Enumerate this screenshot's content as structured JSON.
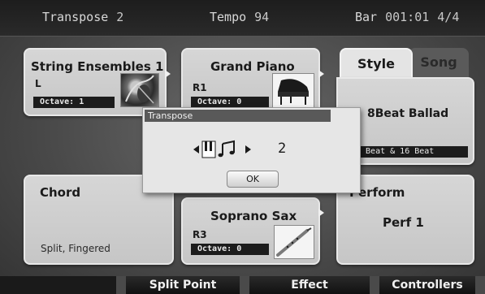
{
  "status_bar": {
    "transpose_label": "Transpose",
    "transpose_value": "2",
    "tempo_label": "Tempo",
    "tempo_value": "94",
    "bar_label": "Bar",
    "bar_value": "001:01",
    "time_signature": "4/4"
  },
  "parts": {
    "left": {
      "voice": "String Ensembles 1",
      "part": "L",
      "octave_label": "Octave:",
      "octave_value": "1"
    },
    "right1": {
      "voice": "Grand Piano",
      "part": "R1",
      "octave_label": "Octave:",
      "octave_value": "0"
    },
    "right3": {
      "voice": "Soprano Sax",
      "part": "R3",
      "octave_label": "Octave:",
      "octave_value": "0"
    }
  },
  "chord": {
    "title": "Chord",
    "mode": "Split, Fingered"
  },
  "style_tabs": {
    "style_label": "Style",
    "song_label": "Song",
    "active": "Style"
  },
  "style": {
    "name": "8Beat Ballad",
    "category": "8 Beat & 16 Beat"
  },
  "perform": {
    "title": "Perform",
    "name": "Perf 1"
  },
  "dialog": {
    "title": "Transpose",
    "value": "2",
    "ok_label": "OK"
  },
  "softkeys": [
    "Split Point",
    "Effect",
    "Controllers"
  ],
  "colors": {
    "panel": "#d0d0d0",
    "dark_bar": "#1c1c1c",
    "dialog_title": "#595959"
  }
}
